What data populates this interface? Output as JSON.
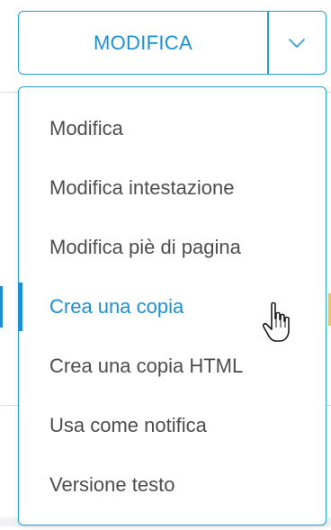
{
  "split_button": {
    "label": "MODIFICA",
    "toggle_icon": "chevron-down-icon"
  },
  "menu": {
    "items": [
      {
        "label": "Modifica"
      },
      {
        "label": "Modifica intestazione"
      },
      {
        "label": "Modifica piè di pagina"
      },
      {
        "label": "Crea una copia",
        "active": true
      },
      {
        "label": "Crea una copia HTML"
      },
      {
        "label": "Usa come notifica"
      },
      {
        "label": "Versione testo"
      }
    ]
  },
  "colors": {
    "accent": "#1d8fd6",
    "border": "#27a0d3",
    "menu_text": "#4d4d4d"
  },
  "cursor": "hand-pointer-icon"
}
